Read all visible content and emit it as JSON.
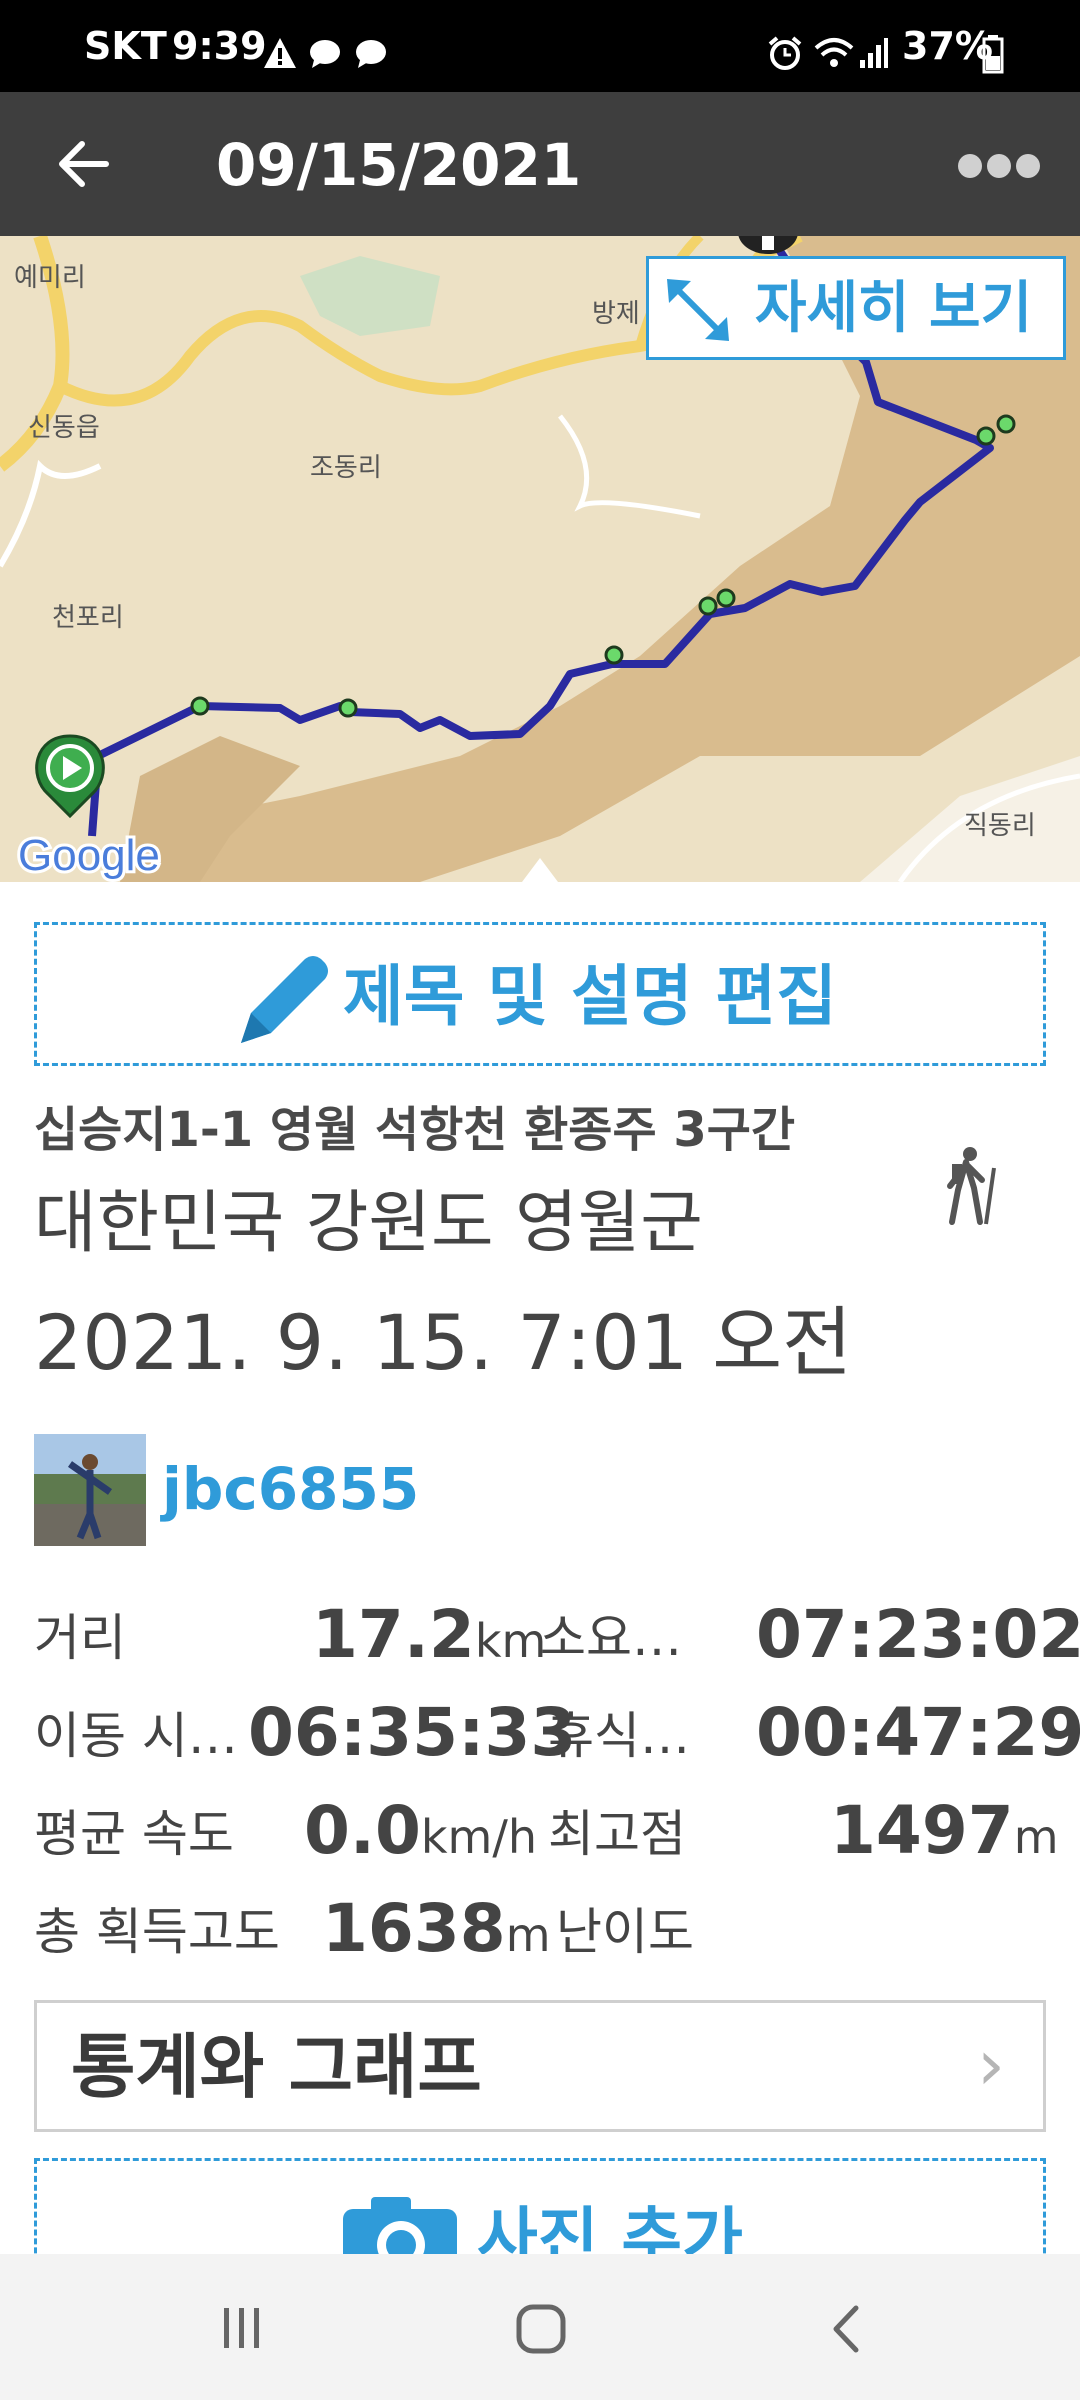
{
  "status_bar": {
    "carrier": "SKT",
    "time": "9:39",
    "battery": "37%",
    "icons": [
      "warning-icon",
      "chat-bubble-icon",
      "chat-bubble-icon",
      "alarm-icon",
      "wifi-icon",
      "signal-icon",
      "battery-icon"
    ]
  },
  "app_bar": {
    "title": "09/15/2021",
    "back_icon": "back-arrow-icon",
    "menu_icon": "more-dots-icon"
  },
  "map": {
    "view_details_label": "자세히 보기",
    "place_labels": [
      "예미리",
      "방제",
      "신동읍",
      "조동리",
      "천포리",
      "직동리"
    ],
    "logo": "Google",
    "route_color": "#2a2aa0"
  },
  "edit_button": {
    "label": "제목 및 설명 편집",
    "icon": "pencil-icon"
  },
  "track": {
    "name": "십승지1-1 영월 석항천 환종주 3구간",
    "location": "대한민국 강원도 영월군",
    "datetime": "2021. 9. 15. 7:01 오전",
    "activity_icon": "hiker-icon"
  },
  "user": {
    "username": "jbc6855"
  },
  "stats": {
    "distance_label": "거리",
    "distance_value": "17.2",
    "distance_unit": "km",
    "total_time_label": "소요…",
    "total_time_value": "07:23:02",
    "moving_time_label": "이동 시…",
    "moving_time_value": "06:35:33",
    "rest_label": "휴식…",
    "rest_value": "00:47:29",
    "avg_speed_label": "평균 속도",
    "avg_speed_value": "0.0",
    "avg_speed_unit": "km/h",
    "max_alt_label": "최고점",
    "max_alt_value": "1497",
    "max_alt_unit": "m",
    "gain_label": "총 획득고도",
    "gain_value": "1638",
    "gain_unit": "m",
    "difficulty_label": "난이도"
  },
  "stats_graph_button": {
    "label": "통계와 그래프",
    "chevron": "›"
  },
  "add_photo_button": {
    "label": "사진 추가",
    "icon": "camera-icon"
  },
  "colors": {
    "accent": "#2f9bd9",
    "appbar": "#3e3e3e",
    "map_bg": "#e9d9b4",
    "terrain": "#d8ba8c"
  }
}
